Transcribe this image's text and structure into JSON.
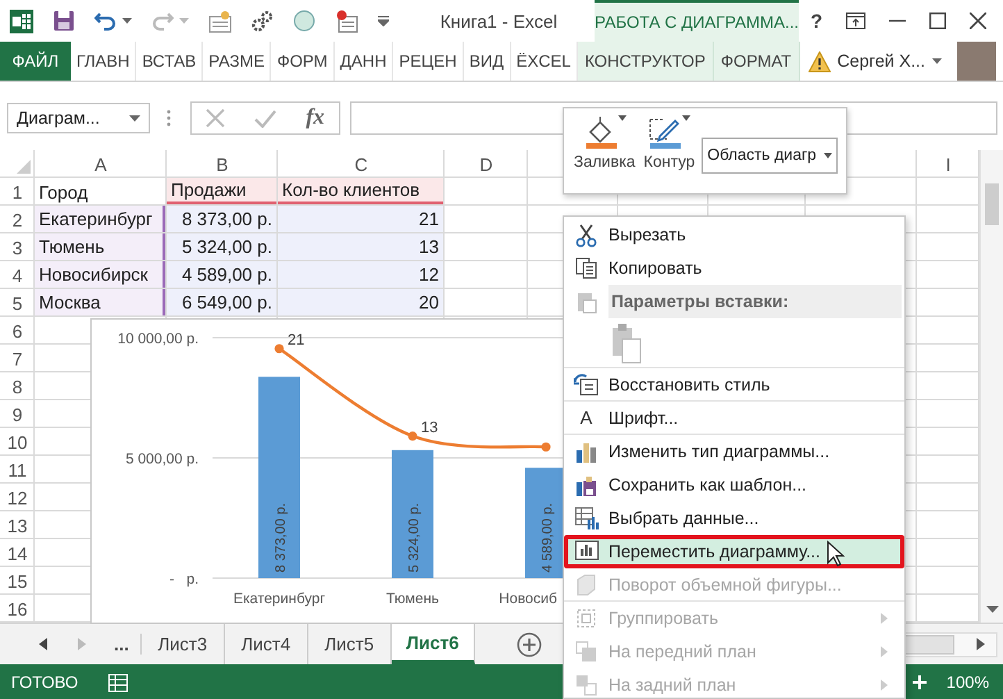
{
  "title_bar": {
    "title": "Книга1 - Excel",
    "context_header": "РАБОТА С ДИАГРАММА...",
    "help": "?"
  },
  "ribbon_tabs": [
    {
      "label": "ФАЙЛ",
      "kind": "file",
      "selected": false
    },
    {
      "label": "ГЛАВН",
      "kind": "tab",
      "selected": false
    },
    {
      "label": "ВСТАВ",
      "kind": "tab",
      "selected": false
    },
    {
      "label": "РАЗМЕ",
      "kind": "tab",
      "selected": false
    },
    {
      "label": "ФОРМ",
      "kind": "tab",
      "selected": false
    },
    {
      "label": "ДАНН",
      "kind": "tab",
      "selected": false
    },
    {
      "label": "РЕЦЕН",
      "kind": "tab",
      "selected": false
    },
    {
      "label": "ВИД",
      "kind": "tab",
      "selected": false
    },
    {
      "label": "ЁXCEL",
      "kind": "tab",
      "selected": false
    },
    {
      "label": "КОНСТРУКТОР",
      "kind": "context",
      "selected": false
    },
    {
      "label": "ФОРМАТ",
      "kind": "context",
      "selected": false
    }
  ],
  "user": {
    "name": "Сергей Х..."
  },
  "formula_bar": {
    "name_box": "Диаграм...",
    "function_button": "fx"
  },
  "mini_toolbar": {
    "fill_label": "Заливка",
    "outline_label": "Контур",
    "element_select": "Область диагр"
  },
  "sheet": {
    "columns": [
      "A",
      "B",
      "C",
      "D",
      "I"
    ],
    "row_numbers": [
      "1",
      "2",
      "3",
      "4",
      "5",
      "6",
      "7",
      "8",
      "9",
      "10",
      "11",
      "12",
      "13",
      "14",
      "15",
      "16"
    ],
    "rows": [
      [
        "Город",
        "Продажи",
        "Кол-во клиентов"
      ],
      [
        "Екатеринбург",
        "8 373,00 р.",
        "21"
      ],
      [
        "Тюмень",
        "5 324,00 р.",
        "13"
      ],
      [
        "Новосибирск",
        "4 589,00 р.",
        "12"
      ],
      [
        "Москва",
        "6 549,00 р.",
        "20"
      ]
    ]
  },
  "chart": {
    "chart_data": {
      "type": "bar",
      "ylim": [
        0,
        10000
      ],
      "yticks": [
        {
          "value": 0,
          "label": "-   р."
        },
        {
          "value": 5000,
          "label": "5 000,00 р."
        },
        {
          "value": 10000,
          "label": "10 000,00 р."
        }
      ],
      "categories": [
        "Екатеринбург",
        "Тюмень",
        "Новосиб"
      ],
      "series": [
        {
          "color": "#5b9bd5",
          "values": [
            8373,
            5324,
            4589
          ],
          "value_labels": [
            "8 373,00 р.",
            "5 324,00 р.",
            "4 589,00 р."
          ]
        },
        {
          "color": "#ed7d31",
          "values": [
            21,
            13,
            12
          ]
        }
      ],
      "annotations": [
        "21",
        "13"
      ]
    }
  },
  "context_menu": {
    "items": [
      {
        "kind": "item",
        "label": "Вырезать",
        "selected": false,
        "disabled": false,
        "submenu": false,
        "divider": false
      },
      {
        "kind": "item",
        "label": "Копировать",
        "selected": false,
        "disabled": false,
        "submenu": false,
        "divider": false
      },
      {
        "kind": "header",
        "label": "Параметры вставки:"
      },
      {
        "kind": "paste-options",
        "divider": true
      },
      {
        "kind": "item",
        "label": "Восстановить стиль",
        "selected": false,
        "disabled": false,
        "submenu": false,
        "divider": true
      },
      {
        "kind": "item",
        "label": "Шрифт...",
        "glyph": "A",
        "selected": false,
        "disabled": false,
        "submenu": false,
        "divider": true
      },
      {
        "kind": "item",
        "label": "Изменить тип диаграммы...",
        "selected": false,
        "disabled": false,
        "submenu": false,
        "divider": false
      },
      {
        "kind": "item",
        "label": "Сохранить как шаблон...",
        "selected": false,
        "disabled": false,
        "submenu": false,
        "divider": false
      },
      {
        "kind": "item",
        "label": "Выбрать данные...",
        "selected": false,
        "disabled": false,
        "submenu": false,
        "divider": false
      },
      {
        "kind": "item",
        "label": "Переместить диаграмму...",
        "selected": true,
        "disabled": false,
        "submenu": false,
        "divider": false
      },
      {
        "kind": "item",
        "label": "Поворот объемной фигуры...",
        "selected": false,
        "disabled": true,
        "submenu": false,
        "divider": true
      },
      {
        "kind": "item",
        "label": "Группировать",
        "selected": false,
        "disabled": true,
        "submenu": true,
        "divider": false
      },
      {
        "kind": "item",
        "label": "На передний план",
        "selected": false,
        "disabled": true,
        "submenu": true,
        "divider": false
      },
      {
        "kind": "item",
        "label": "На задний план",
        "selected": false,
        "disabled": true,
        "submenu": true,
        "divider": false
      }
    ]
  },
  "sheet_tabs": {
    "overflow": "...",
    "tabs": [
      {
        "label": "Лист3",
        "selected": false
      },
      {
        "label": "Лист4",
        "selected": false
      },
      {
        "label": "Лист5",
        "selected": false
      },
      {
        "label": "Лист6",
        "selected": true
      }
    ]
  },
  "status_bar": {
    "mode": "ГОТОВО",
    "zoom": "100%"
  }
}
